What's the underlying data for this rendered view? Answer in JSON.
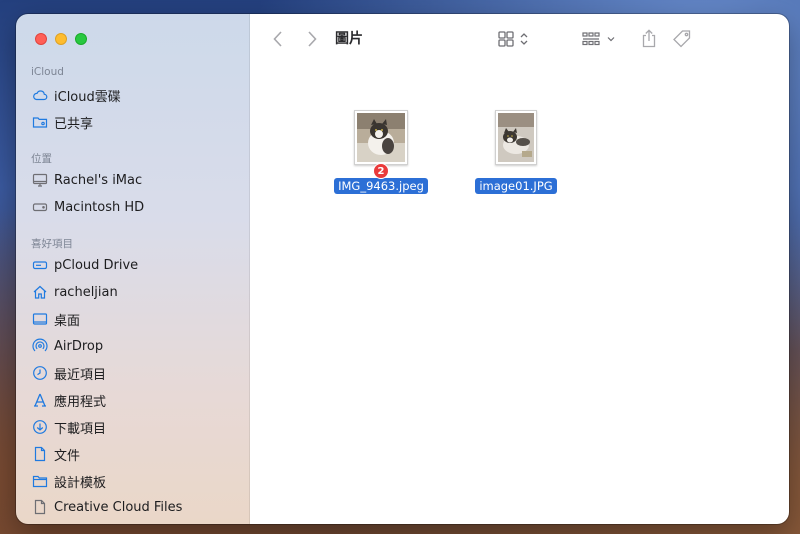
{
  "window": {
    "title": "圖片"
  },
  "sidebar": {
    "sections": [
      {
        "title": "iCloud"
      },
      {
        "title": "位置"
      },
      {
        "title": "喜好項目"
      }
    ],
    "icloud_items": [
      {
        "label": "iCloud雲碟",
        "icon": "icloud-icon"
      },
      {
        "label": "已共享",
        "icon": "shared-folder-icon"
      }
    ],
    "location_items": [
      {
        "label": "Rachel's iMac",
        "icon": "imac-icon"
      },
      {
        "label": "Macintosh HD",
        "icon": "disk-icon"
      }
    ],
    "favorite_items": [
      {
        "label": "pCloud Drive",
        "icon": "drive-icon"
      },
      {
        "label": "racheljian",
        "icon": "home-icon"
      },
      {
        "label": "桌面",
        "icon": "desktop-icon"
      },
      {
        "label": "AirDrop",
        "icon": "airdrop-icon"
      },
      {
        "label": "最近項目",
        "icon": "clock-icon"
      },
      {
        "label": "應用程式",
        "icon": "apps-icon"
      },
      {
        "label": "下載項目",
        "icon": "download-icon"
      },
      {
        "label": "文件",
        "icon": "document-icon"
      },
      {
        "label": "設計模板",
        "icon": "folder-icon"
      },
      {
        "label": "Creative Cloud Files",
        "icon": "file-icon"
      }
    ]
  },
  "files": [
    {
      "name": "IMG_9463.jpeg",
      "badge": "2",
      "selected": true
    },
    {
      "name": "image01.JPG",
      "selected": true
    }
  ],
  "colors": {
    "accent": "#1f7ae0",
    "selection": "#2c6fd6",
    "badge": "#ea3b3b"
  }
}
